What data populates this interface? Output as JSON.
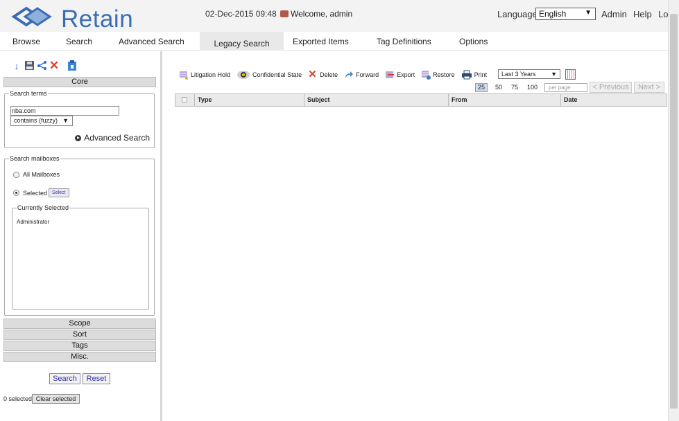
{
  "header": {
    "logo_text": "Retain",
    "datetime": "02-Dec-2015 09:48",
    "welcome": "Welcome, admin",
    "language_label": "Language",
    "language_value": "English",
    "links": [
      "Admin",
      "Help",
      "Lo"
    ]
  },
  "tabs": [
    {
      "label": "Browse",
      "active": false
    },
    {
      "label": "Search",
      "active": false
    },
    {
      "label": "Advanced Search",
      "active": false
    },
    {
      "label": "Legacy Search",
      "active": true
    },
    {
      "label": "Exported Items",
      "active": false
    },
    {
      "label": "Tag Definitions",
      "active": false
    },
    {
      "label": "Options",
      "active": false
    }
  ],
  "left_panel": {
    "tool_icons": [
      "download-icon",
      "save-icon",
      "share-icon",
      "delete-icon",
      "clipboard-icon"
    ],
    "core_label": "Core",
    "search_terms": {
      "legend": "Search terms",
      "value": "nba.com",
      "match_mode": "contains (fuzzy)",
      "advanced_link": "Advanced Search"
    },
    "mailboxes": {
      "legend": "Search mailboxes",
      "all_label": "All Mailboxes",
      "selected_label": "Selected",
      "select_button": "Select",
      "current_legend": "Currently Selected",
      "current_items": [
        "Administrator"
      ]
    },
    "sections": [
      "Scope",
      "Sort",
      "Tags",
      "Misc."
    ],
    "search_button": "Search",
    "reset_button": "Reset",
    "selected_count": "0 selected",
    "clear_button": "Clear selected"
  },
  "toolbar": {
    "items": [
      "Litigation Hold",
      "Confidential State",
      "Delete",
      "Forward",
      "Export",
      "Restore",
      "Print"
    ],
    "date_range": "Last 3 Years"
  },
  "pager": {
    "sizes": [
      "25",
      "50",
      "75",
      "100"
    ],
    "active_size": "25",
    "per_page_placeholder": "per page",
    "previous": "< Previous",
    "next": "Next >"
  },
  "table": {
    "columns": [
      "Type",
      "Subject",
      "From",
      "Date"
    ]
  },
  "colors": {
    "brand": "#3b6db5",
    "link": "#2d2daa"
  }
}
